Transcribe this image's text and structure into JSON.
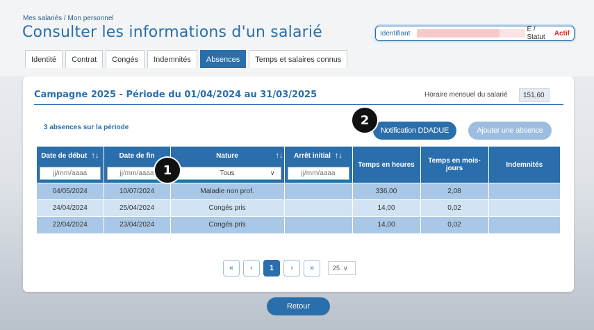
{
  "breadcrumb": "Mes salariés / Mon personnel",
  "page_title": "Consulter les informations d'un salarié",
  "identity": {
    "label": "Identifiant",
    "separator": "E / Statut",
    "status": "Actif"
  },
  "tabs": [
    {
      "label": "Identité",
      "active": false
    },
    {
      "label": "Contrat",
      "active": false
    },
    {
      "label": "Congés",
      "active": false
    },
    {
      "label": "Indemnités",
      "active": false
    },
    {
      "label": "Absences",
      "active": true
    },
    {
      "label": "Temps et salaires connus",
      "active": false
    }
  ],
  "campaign_title": "Campagne 2025 - Période du 01/04/2024 au 31/03/2025",
  "horaire": {
    "label": "Horaire mensuel du salarié",
    "value": "151,60"
  },
  "absence_count": "3 absences sur la période",
  "buttons": {
    "notification": "Notification DDADUE",
    "add_absence": "Ajouter une absence",
    "back": "Retour"
  },
  "markers": {
    "one": "1",
    "two": "2"
  },
  "table": {
    "headers": {
      "date_debut": "Date de début",
      "date_fin": "Date de fin",
      "nature": "Nature",
      "arret_initial": "Arrêt initial",
      "temps_heures": "Temps en heures",
      "temps_mois_jours": "Temps en mois-jours",
      "indemnites": "Indemnités"
    },
    "filters": {
      "date_placeholder": "jj/mm/aaaa",
      "nature_selected": "Tous"
    },
    "rows": [
      [
        "04/05/2024",
        "10/07/2024",
        "Maladie non prof.",
        "",
        "336,00",
        "2,08",
        ""
      ],
      [
        "24/04/2024",
        "25/04/2024",
        "Congés pris",
        "",
        "14,00",
        "0,02",
        ""
      ],
      [
        "22/04/2024",
        "23/04/2024",
        "Congés pris",
        "",
        "14,00",
        "0,02",
        ""
      ]
    ]
  },
  "pager": {
    "first": "«",
    "prev": "‹",
    "current": "1",
    "next": "›",
    "last": "»",
    "page_size": "25"
  },
  "icons": {
    "sort": "↑↓",
    "chevron": "∨"
  },
  "colors": {
    "primary": "#2a6eab",
    "status_active": "#d9282a",
    "row_odd": "#a9c7e6",
    "row_even": "#d2e3f3"
  }
}
